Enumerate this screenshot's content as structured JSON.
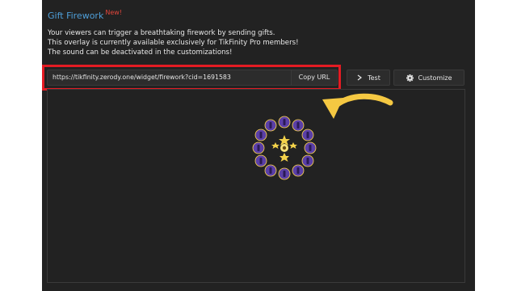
{
  "header": {
    "title": "Gift Firework",
    "badge": "New!"
  },
  "description": [
    "Your viewers can trigger a breathtaking firework by sending gifts.",
    "This overlay is currently available exclusively for TikFinity Pro members!",
    "The sound can be deactivated in the customizations!"
  ],
  "widget": {
    "url": "https://tikfinity.zerody.one/widget/firework?cid=1691583",
    "copy_label": "Copy URL",
    "test_label": "Test",
    "customize_label": "Customize"
  },
  "icons": {
    "test": "chevron-right-icon",
    "customize": "gear-icon"
  },
  "colors": {
    "panel_bg": "#222222",
    "title": "#4e9fd9",
    "badge": "#e2453b",
    "highlight": "#e31b23",
    "arrow": "#f5c842",
    "gift_ring": "#5a3fa8",
    "gift_star": "#f3d24a"
  }
}
